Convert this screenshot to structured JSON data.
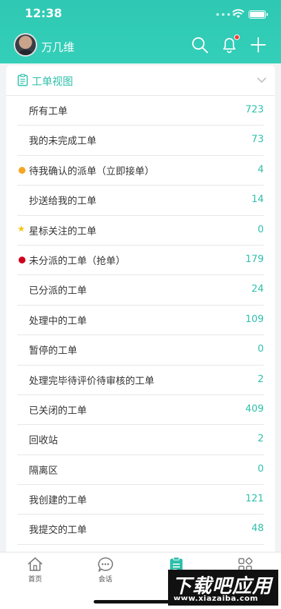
{
  "status_bar": {
    "time": "12:38"
  },
  "header": {
    "username": "万几维"
  },
  "card": {
    "title": "工单视图",
    "rows": [
      {
        "label": "所有工单",
        "count": "723",
        "marker": ""
      },
      {
        "label": "我的未完成工单",
        "count": "73",
        "marker": ""
      },
      {
        "label": "待我确认的派单（立即接单）",
        "count": "4",
        "marker": "orange-dot"
      },
      {
        "label": "抄送给我的工单",
        "count": "14",
        "marker": ""
      },
      {
        "label": "星标关注的工单",
        "count": "0",
        "marker": "star"
      },
      {
        "label": "未分派的工单（抢单）",
        "count": "179",
        "marker": "red-dot"
      },
      {
        "label": "已分派的工单",
        "count": "24",
        "marker": ""
      },
      {
        "label": "处理中的工单",
        "count": "109",
        "marker": ""
      },
      {
        "label": "暂停的工单",
        "count": "0",
        "marker": ""
      },
      {
        "label": "处理完毕待评价待审核的工单",
        "count": "2",
        "marker": ""
      },
      {
        "label": "已关闭的工单",
        "count": "409",
        "marker": ""
      },
      {
        "label": "回收站",
        "count": "2",
        "marker": ""
      },
      {
        "label": "隔离区",
        "count": "0",
        "marker": ""
      },
      {
        "label": "我创建的工单",
        "count": "121",
        "marker": ""
      },
      {
        "label": "我提交的工单",
        "count": "48",
        "marker": ""
      }
    ]
  },
  "tabbar": {
    "tabs": [
      {
        "label": "首页",
        "icon": "home-icon"
      },
      {
        "label": "会话",
        "icon": "chat-icon"
      },
      {
        "label": "",
        "icon": "workorder-icon"
      },
      {
        "label": "",
        "icon": "apps-icon"
      }
    ]
  },
  "watermark": {
    "big": "下载吧应用",
    "small": "www.xiazaiba.com"
  },
  "colors": {
    "accent": "#2dbfaa",
    "header": "#34cfb9",
    "orange": "#f5a623",
    "red": "#d0021b",
    "star": "#f5c518"
  }
}
